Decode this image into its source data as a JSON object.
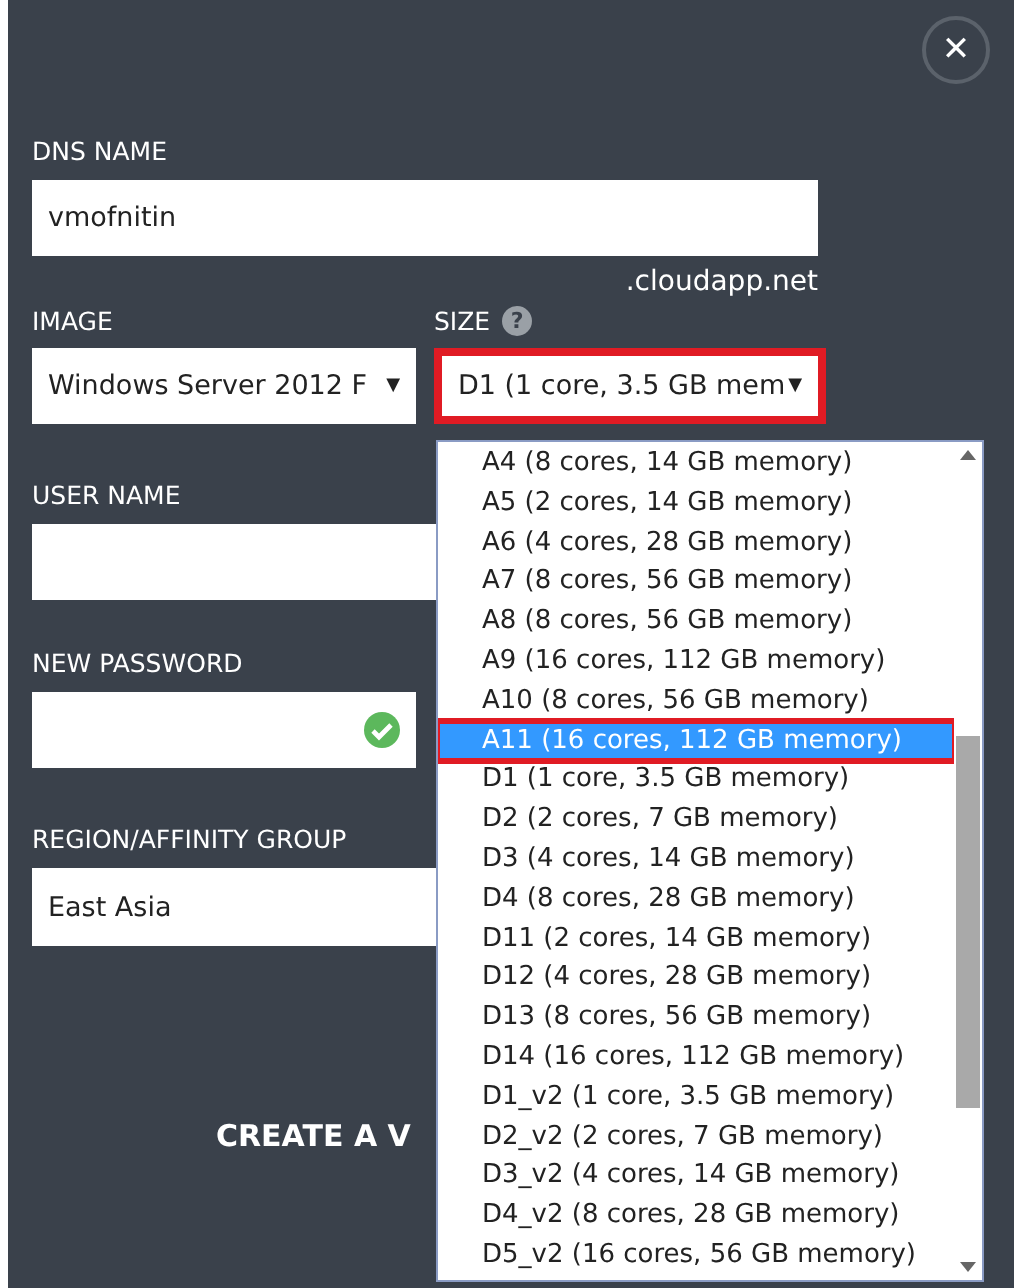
{
  "close_button": {
    "label": "✕"
  },
  "dns_name": {
    "label": "DNS NAME",
    "value": "vmofnitin",
    "suffix": ".cloudapp.net"
  },
  "image": {
    "label": "IMAGE",
    "value": "Windows Server 2012 F",
    "arrow": "▼"
  },
  "size": {
    "label": "SIZE",
    "help": "?",
    "value": "D1 (1 core, 3.5 GB mem",
    "arrow": "▼",
    "expanded": true
  },
  "user_name": {
    "label": "USER NAME"
  },
  "new_password": {
    "label": "NEW PASSWORD",
    "valid": true
  },
  "region": {
    "label": "REGION/AFFINITY GROUP",
    "value": "East Asia"
  },
  "create_button": {
    "label": "CREATE A V"
  },
  "size_options": [
    {
      "label": "A4 (8 cores, 14 GB memory)",
      "selected": false
    },
    {
      "label": "A5 (2 cores, 14 GB memory)",
      "selected": false
    },
    {
      "label": "A6 (4 cores, 28 GB memory)",
      "selected": false
    },
    {
      "label": "A7 (8 cores, 56 GB memory)",
      "selected": false
    },
    {
      "label": "A8 (8 cores, 56 GB memory)",
      "selected": false
    },
    {
      "label": "A9 (16 cores, 112 GB memory)",
      "selected": false
    },
    {
      "label": "A10 (8 cores, 56 GB memory)",
      "selected": false
    },
    {
      "label": "A11 (16 cores, 112 GB memory)",
      "selected": true
    },
    {
      "label": "D1 (1 core, 3.5 GB memory)",
      "selected": false
    },
    {
      "label": "D2 (2 cores, 7 GB memory)",
      "selected": false
    },
    {
      "label": "D3 (4 cores, 14 GB memory)",
      "selected": false
    },
    {
      "label": "D4 (8 cores, 28 GB memory)",
      "selected": false
    },
    {
      "label": "D11 (2 cores, 14 GB memory)",
      "selected": false
    },
    {
      "label": "D12 (4 cores, 28 GB memory)",
      "selected": false
    },
    {
      "label": "D13 (8 cores, 56 GB memory)",
      "selected": false
    },
    {
      "label": "D14 (16 cores, 112 GB memory)",
      "selected": false
    },
    {
      "label": "D1_v2 (1 core, 3.5 GB memory)",
      "selected": false
    },
    {
      "label": "D2_v2 (2 cores, 7 GB memory)",
      "selected": false
    },
    {
      "label": "D3_v2 (4 cores, 14 GB memory)",
      "selected": false
    },
    {
      "label": "D4_v2 (8 cores, 28 GB memory)",
      "selected": false
    },
    {
      "label": "D5_v2 (16 cores, 56 GB memory)",
      "selected": false
    }
  ]
}
